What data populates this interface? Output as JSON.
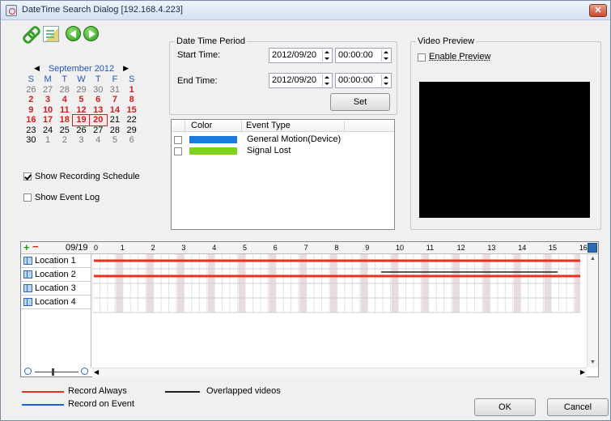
{
  "window": {
    "title": "DateTime Search Dialog  [192.168.4.223]",
    "close_label": "✕"
  },
  "calendar": {
    "month_label": "September 2012",
    "days_of_week": [
      "S",
      "M",
      "T",
      "W",
      "T",
      "F",
      "S"
    ],
    "weeks": [
      [
        {
          "d": "26",
          "s": "dim"
        },
        {
          "d": "27",
          "s": "dim"
        },
        {
          "d": "28",
          "s": "dim"
        },
        {
          "d": "29",
          "s": "dim"
        },
        {
          "d": "30",
          "s": "dim"
        },
        {
          "d": "31",
          "s": "dim"
        },
        {
          "d": "1",
          "s": "hl"
        }
      ],
      [
        {
          "d": "2",
          "s": "hl"
        },
        {
          "d": "3",
          "s": "hl"
        },
        {
          "d": "4",
          "s": "hl"
        },
        {
          "d": "5",
          "s": "hl"
        },
        {
          "d": "6",
          "s": "hl"
        },
        {
          "d": "7",
          "s": "hl"
        },
        {
          "d": "8",
          "s": "hl"
        }
      ],
      [
        {
          "d": "9",
          "s": "hl"
        },
        {
          "d": "10",
          "s": "hl"
        },
        {
          "d": "11",
          "s": "hl"
        },
        {
          "d": "12",
          "s": "hl"
        },
        {
          "d": "13",
          "s": "hl"
        },
        {
          "d": "14",
          "s": "hl"
        },
        {
          "d": "15",
          "s": "hl"
        }
      ],
      [
        {
          "d": "16",
          "s": "hl"
        },
        {
          "d": "17",
          "s": "hl"
        },
        {
          "d": "18",
          "s": "hl"
        },
        {
          "d": "19",
          "s": "hl sel"
        },
        {
          "d": "20",
          "s": "hl today"
        },
        {
          "d": "21",
          "s": ""
        },
        {
          "d": "22",
          "s": ""
        }
      ],
      [
        {
          "d": "23",
          "s": ""
        },
        {
          "d": "24",
          "s": ""
        },
        {
          "d": "25",
          "s": ""
        },
        {
          "d": "26",
          "s": ""
        },
        {
          "d": "27",
          "s": ""
        },
        {
          "d": "28",
          "s": ""
        },
        {
          "d": "29",
          "s": ""
        }
      ],
      [
        {
          "d": "30",
          "s": ""
        },
        {
          "d": "1",
          "s": "dim"
        },
        {
          "d": "2",
          "s": "dim"
        },
        {
          "d": "3",
          "s": "dim"
        },
        {
          "d": "4",
          "s": "dim"
        },
        {
          "d": "5",
          "s": "dim"
        },
        {
          "d": "6",
          "s": "dim"
        }
      ]
    ]
  },
  "options": {
    "show_recording_schedule": {
      "label": "Show Recording Schedule",
      "checked": true
    },
    "show_event_log": {
      "label": "Show Event Log",
      "checked": false
    }
  },
  "date_time_period": {
    "group_label": "Date Time Period",
    "start_label": "Start Time:",
    "start_date": "2012/09/20",
    "start_time": "00:00:00",
    "end_label": "End Time:",
    "end_date": "2012/09/20",
    "end_time": "00:00:00",
    "set_label": "Set"
  },
  "events": {
    "col_color": "Color",
    "col_event_type": "Event Type",
    "rows": [
      {
        "label": "General Motion(Device)",
        "color": "#1a7ae0",
        "checked": false
      },
      {
        "label": "Signal Lost",
        "color": "#7ed321",
        "checked": false
      }
    ]
  },
  "video_preview": {
    "group_label": "Video Preview",
    "enable_label": "Enable Preview",
    "enabled": false
  },
  "timeline": {
    "date_label": "09/19",
    "hour_labels": [
      "0",
      "1",
      "2",
      "3",
      "4",
      "5",
      "6",
      "7",
      "8",
      "9",
      "10",
      "11",
      "12",
      "13",
      "14",
      "15",
      "16"
    ],
    "locations": [
      "Location 1",
      "Location 2",
      "Location 3",
      "Location 4"
    ]
  },
  "legend": {
    "record_always": {
      "label": "Record Always",
      "color": "#e8321e"
    },
    "record_on_event": {
      "label": "Record on Event",
      "color": "#1a5fe8"
    },
    "overlapped": {
      "label": "Overlapped videos",
      "color": "#222222"
    }
  },
  "buttons": {
    "ok": "OK",
    "cancel": "Cancel"
  }
}
